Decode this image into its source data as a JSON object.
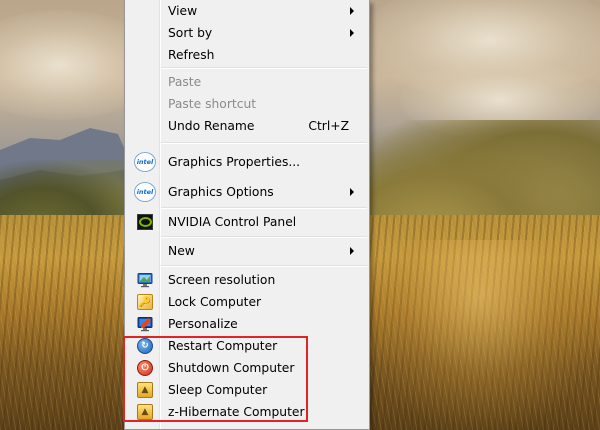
{
  "desktop": {
    "wallpaper": "landscape with mountains, trees and golden grass"
  },
  "context_menu": {
    "groups": [
      [
        {
          "label": "View",
          "submenu": true
        },
        {
          "label": "Sort by",
          "submenu": true
        },
        {
          "label": "Refresh"
        }
      ],
      [
        {
          "label": "Paste",
          "disabled": true
        },
        {
          "label": "Paste shortcut",
          "disabled": true
        },
        {
          "label": "Undo Rename",
          "shortcut": "Ctrl+Z"
        }
      ],
      [
        {
          "label": "Graphics Properties...",
          "icon": "intel-icon",
          "icon_text": "intel"
        },
        {
          "label": "Graphics Options",
          "icon": "intel-icon",
          "icon_text": "intel",
          "submenu": true
        }
      ],
      [
        {
          "label": "NVIDIA Control Panel",
          "icon": "nvidia-icon"
        }
      ],
      [
        {
          "label": "New",
          "submenu": true
        }
      ],
      [
        {
          "label": "Screen resolution",
          "icon": "monitor-icon"
        },
        {
          "label": "Lock Computer",
          "icon": "lock-icon"
        },
        {
          "label": "Personalize",
          "icon": "personalize-icon"
        },
        {
          "label": "Restart Computer",
          "icon": "restart-icon"
        },
        {
          "label": "Shutdown Computer",
          "icon": "shutdown-icon"
        },
        {
          "label": "Sleep Computer",
          "icon": "sleep-icon"
        },
        {
          "label": "z-Hibernate Computer",
          "icon": "hibernate-icon"
        }
      ]
    ]
  },
  "colors": {
    "menu_background": "#f0f0f0",
    "highlight_box": "#e02424",
    "disabled_text": "#8b8b8b"
  }
}
